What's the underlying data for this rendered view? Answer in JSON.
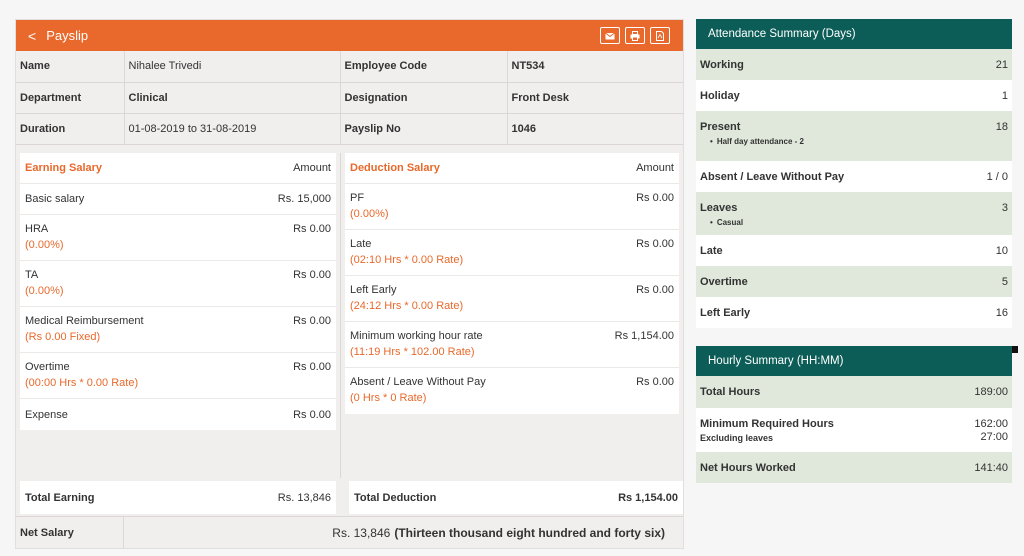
{
  "payslip": {
    "back_icon": "chevron-left-icon",
    "title": "Payslip",
    "actions": [
      "mail-icon",
      "print-icon",
      "pdf-icon"
    ],
    "info": {
      "name_label": "Name",
      "name_value": "Nihalee Trivedi",
      "code_label": "Employee Code",
      "code_value": "NT534",
      "dept_label": "Department",
      "dept_value": "Clinical",
      "desig_label": "Designation",
      "desig_value": "Front Desk",
      "duration_label": "Duration",
      "duration_value": "01-08-2019 to 31-08-2019",
      "slip_label": "Payslip No",
      "slip_value": "1046"
    },
    "earning": {
      "title": "Earning Salary",
      "amount_label": "Amount",
      "items": [
        {
          "name": "Basic salary",
          "sub": "",
          "amount": "Rs. 15,000"
        },
        {
          "name": "HRA",
          "sub": "(0.00%)",
          "amount": "Rs 0.00"
        },
        {
          "name": "TA",
          "sub": "(0.00%)",
          "amount": "Rs 0.00"
        },
        {
          "name": "Medical Reimbursement",
          "sub": "(Rs 0.00 Fixed)",
          "amount": "Rs 0.00"
        },
        {
          "name": "Overtime",
          "sub": "(00:00 Hrs * 0.00 Rate)",
          "amount": "Rs 0.00"
        },
        {
          "name": "Expense",
          "sub": "",
          "amount": "Rs 0.00"
        }
      ],
      "total_label": "Total Earning",
      "total_value": "Rs. 13,846"
    },
    "deduction": {
      "title": "Deduction Salary",
      "amount_label": "Amount",
      "items": [
        {
          "name": "PF",
          "sub": "(0.00%)",
          "amount": "Rs 0.00"
        },
        {
          "name": "Late",
          "sub": "(02:10 Hrs * 0.00 Rate)",
          "amount": "Rs 0.00"
        },
        {
          "name": "Left Early",
          "sub": "(24:12 Hrs * 0.00 Rate)",
          "amount": "Rs 0.00"
        },
        {
          "name": "Minimum working hour rate",
          "sub": "(11:19 Hrs * 102.00 Rate)",
          "amount": "Rs 1,154.00"
        },
        {
          "name": "Absent / Leave Without Pay",
          "sub": "(0 Hrs * 0 Rate)",
          "amount": "Rs 0.00"
        }
      ],
      "total_label": "Total Deduction",
      "total_value": "Rs 1,154.00"
    },
    "net": {
      "label": "Net Salary",
      "value": "Rs. 13,846",
      "words": "(Thirteen thousand eight hundred and forty six)"
    }
  },
  "attendance": {
    "title": "Attendance Summary (Days)",
    "rows": [
      {
        "label": "Working",
        "value": "21"
      },
      {
        "label": "Holiday",
        "value": "1"
      },
      {
        "label": "Present",
        "value": "18",
        "note": "Half day attendance - 2"
      },
      {
        "label": "Absent / Leave Without Pay",
        "value": "1 / 0"
      },
      {
        "label": "Leaves",
        "value": "3",
        "note": "Casual"
      },
      {
        "label": "Late",
        "value": "10"
      },
      {
        "label": "Overtime",
        "value": "5"
      },
      {
        "label": "Left Early",
        "value": "16"
      }
    ]
  },
  "hourly": {
    "title": "Hourly Summary (HH:MM)",
    "total_label": "Total Hours",
    "total_value": "189:00",
    "min_label": "Minimum Required Hours",
    "min_value": "162:00",
    "excl_label": "Excluding leaves",
    "excl_value": "27:00",
    "net_label": "Net Hours Worked",
    "net_value": "141:40"
  },
  "colors": {
    "accent": "#e8692b",
    "teal": "#0c5d58",
    "alt_row": "#dfe8da"
  }
}
